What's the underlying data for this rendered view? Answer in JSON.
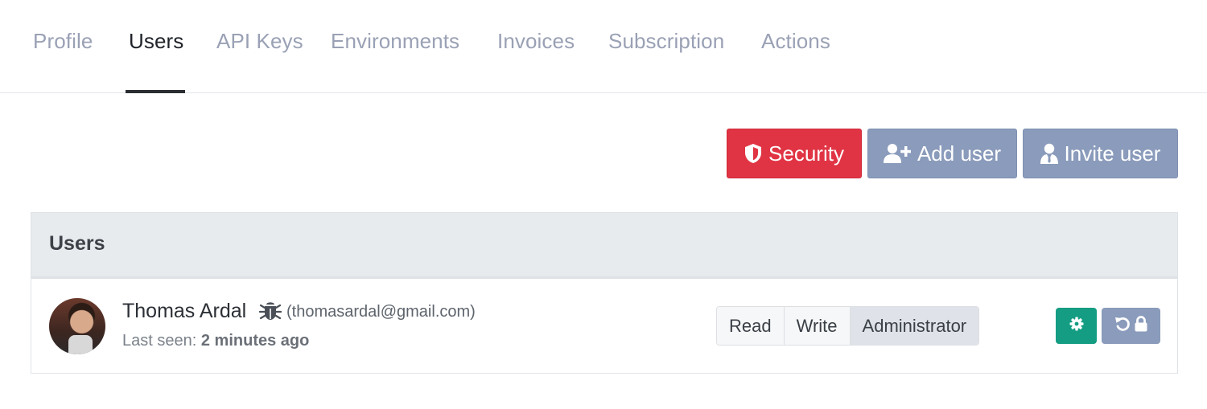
{
  "tabs": [
    {
      "label": "Profile",
      "active": false
    },
    {
      "label": "Users",
      "active": true
    },
    {
      "label": "API Keys",
      "active": false
    },
    {
      "label": "Environments",
      "active": false
    },
    {
      "label": "Invoices",
      "active": false
    },
    {
      "label": "Subscription",
      "active": false
    },
    {
      "label": "Actions",
      "active": false
    }
  ],
  "toolbar": {
    "security_label": "Security",
    "add_user_label": "Add user",
    "invite_user_label": "Invite user"
  },
  "users_card": {
    "title": "Users",
    "user": {
      "name": "Thomas Ardal",
      "email": "(thomasardal@gmail.com)",
      "last_seen_label": "Last seen:",
      "last_seen_value": "2 minutes ago",
      "roles": [
        {
          "label": "Read",
          "active": false
        },
        {
          "label": "Write",
          "active": false
        },
        {
          "label": "Administrator",
          "active": true
        }
      ]
    }
  },
  "icons": {
    "security": "shield-icon",
    "add_user": "user-plus-icon",
    "invite_user": "user-tie-icon",
    "badge": "bug-icon",
    "settings": "cog-icon",
    "reset": "undo-icon",
    "lock": "lock-icon"
  },
  "colors": {
    "danger": "#e03444",
    "secondary": "#8a9bbb",
    "success": "#159d83",
    "tab_inactive": "#9aa1b5",
    "tab_active": "#1f2329"
  }
}
